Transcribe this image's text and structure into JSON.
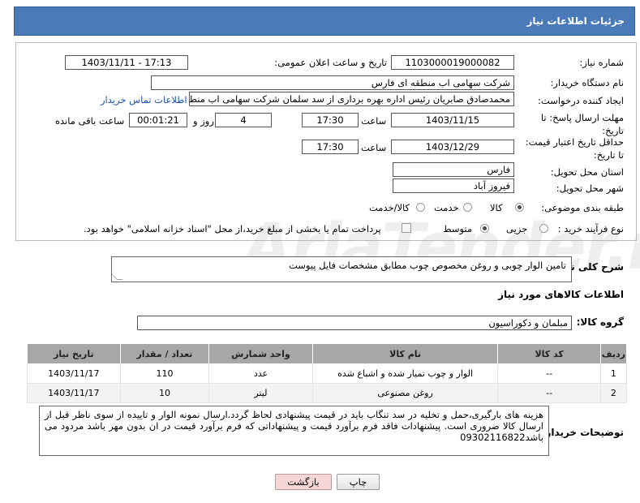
{
  "header": {
    "title": "جزئیات اطلاعات نیاز"
  },
  "form": {
    "need_number": {
      "label": "شماره نیاز:",
      "value": "1103000019000082"
    },
    "announce": {
      "label": "تاریخ و ساعت اعلان عمومی:",
      "value": "1403/11/11 - 17:13"
    },
    "buyer_org": {
      "label": "نام دستگاه خریدار:",
      "value": "شرکت سهامی اب منطقه ای فارس"
    },
    "creator": {
      "label": "ایجاد کننده درخواست:",
      "value": "محمدصادق صابریان رئیس اداره بهره برداری از سد سلمان شرکت سهامی اب منطقه ای فارس",
      "link": "اطلاعات تماس خریدار"
    },
    "deadline": {
      "label": "مهلت ارسال پاسخ: تا تاریخ:",
      "date": "1403/11/15",
      "time_label": "ساعت",
      "time": "17:30",
      "days": "4",
      "days_label": "روز و",
      "remaining": "00:01:21",
      "remaining_label": "ساعت باقی مانده"
    },
    "price_validity": {
      "label": "حداقل تاریخ اعتبار قیمت: تا تاریخ:",
      "date": "1403/12/29",
      "time_label": "ساعت",
      "time": "17:30"
    },
    "province": {
      "label": "استان محل تحویل:",
      "value": "فارس"
    },
    "city": {
      "label": "شهر محل تحویل:",
      "value": "فیروز آباد"
    },
    "category": {
      "label": "طبقه بندی موضوعی:",
      "options": [
        "کالا",
        "خدمت",
        "کالا/خدمت"
      ],
      "selected": "کالا"
    },
    "process": {
      "label": "نوع فرآیند خرید :",
      "options": [
        "جزیی",
        "متوسط"
      ],
      "selected": "متوسط",
      "note": "پرداخت تمام یا بخشی از مبلغ خرید،از محل \"اسناد خزانه اسلامی\" خواهد بود."
    }
  },
  "description": {
    "label": "شرح کلی نیاز:",
    "value": "تامین الوار چوبی و روغن مخصوص چوب مطابق مشخصات فایل پیوست"
  },
  "goods_info_title": "اطلاعات کالاهای مورد نیاز",
  "goods_group": {
    "label": "گروه کالا:",
    "value": "مبلمان و دکوراسیون"
  },
  "table": {
    "headers": [
      "ردیف",
      "کد کالا",
      "نام کالا",
      "واحد شمارش",
      "تعداد / مقدار",
      "تاریخ نیاز"
    ],
    "rows": [
      [
        "1",
        "--",
        "الوار و چوب تمیار شده و اشباع شده",
        "عدد",
        "110",
        "1403/11/17"
      ],
      [
        "2",
        "--",
        "روغن مصنوعی",
        "لیتر",
        "10",
        "1403/11/17"
      ]
    ]
  },
  "buyer_notes": {
    "label": "توضیحات خریدار:",
    "value": "هزینه های بارگیری،حمل و تخلیه در سد تنگاب باید در قیمت پیشنهادی لحاظ گردد.ارسال نمونه الوار و تاییده از سوی ناظر قبل از ارسال کالا ضروری است. پیشنهادات فاقد فرم برآورد قیمت و پیشنهاداتی که فرم برآورد قیمت در ان بدون مهر باشد مردود می باشد09302116822"
  },
  "buttons": {
    "print": "چاپ",
    "back": "بازگشت"
  },
  "watermark": "AriaTender.neT",
  "colors": {
    "header": "#4a7bb8",
    "table_header": "#a7a7a7",
    "link": "#1b4fb3",
    "back_button_bg": "#f7d6d6"
  }
}
